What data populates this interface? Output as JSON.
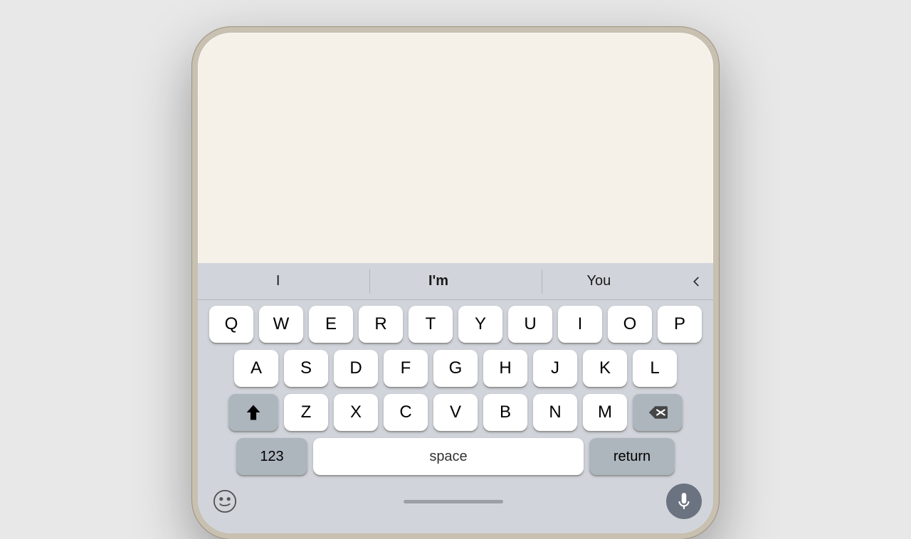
{
  "predictive": {
    "words": [
      "I",
      "I'm",
      "You"
    ],
    "backspace_label": "‹"
  },
  "keyboard": {
    "rows": [
      [
        "Q",
        "W",
        "E",
        "R",
        "T",
        "Y",
        "U",
        "I",
        "O",
        "P"
      ],
      [
        "A",
        "S",
        "D",
        "F",
        "G",
        "H",
        "J",
        "K",
        "L"
      ],
      [
        "Z",
        "X",
        "C",
        "V",
        "B",
        "N",
        "M"
      ]
    ],
    "bottom_row": {
      "numbers_label": "123",
      "space_label": "space",
      "return_label": "return"
    }
  },
  "colors": {
    "keyboard_bg": "#d1d5db",
    "key_bg": "#ffffff",
    "special_key_bg": "#adb5bd",
    "key_shadow": "#999999"
  }
}
